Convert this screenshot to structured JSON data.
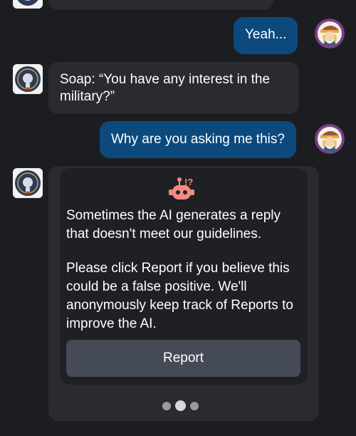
{
  "messages": {
    "user_1": "Yeah...",
    "bot_1": "Soap: “You have any interest in the military?”",
    "user_2": "Why are you asking me this?"
  },
  "flagged": {
    "text_1": "Sometimes the AI generates a reply that doesn't meet our guidelines.",
    "text_2": "Please click Report if you believe this could be a false positive. We'll anonymously keep track of Reports to improve the AI.",
    "report_label": "Report",
    "icon": "robot-warning-icon"
  },
  "colors": {
    "background": "#1c1d21",
    "user_bubble": "#0c4a7e",
    "bot_bubble": "#2a2b30",
    "report_button": "#454a57",
    "robot_icon": "#f28b82"
  }
}
